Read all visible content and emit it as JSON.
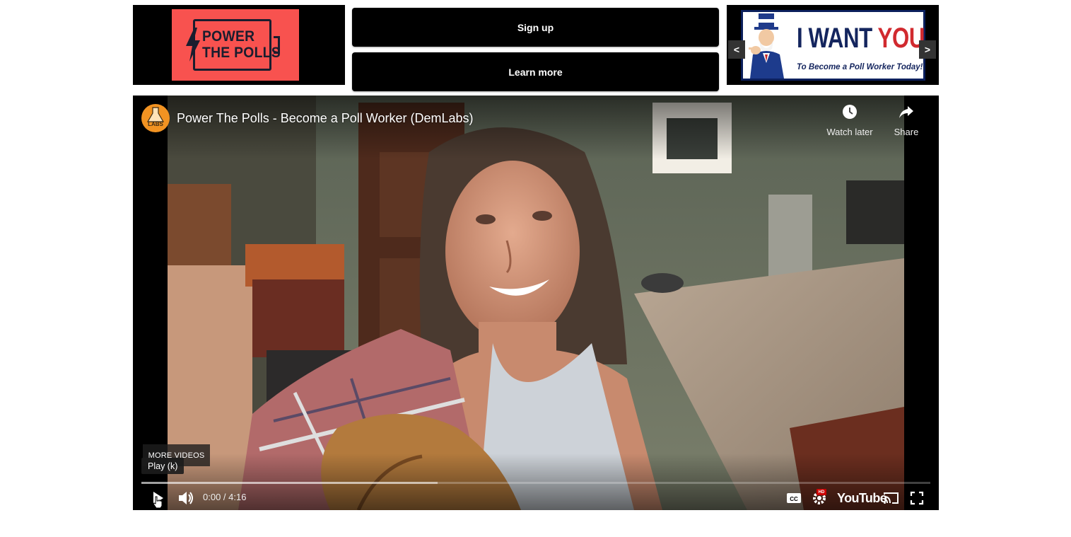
{
  "header": {
    "logo": {
      "line1": "POWER",
      "line2": "THE POLLS"
    },
    "buttons": {
      "signup": "Sign up",
      "learn_more": "Learn more"
    },
    "banner": {
      "headline_part1": "I WANT ",
      "headline_part2": "YOU",
      "subline": "To Become a Poll Worker Today!",
      "prev_label": "<",
      "next_label": ">"
    }
  },
  "video": {
    "title": "Power The Polls - Become a Poll Worker (DemLabs)",
    "channel_avatar_text": "LABS",
    "watch_later_label": "Watch later",
    "share_label": "Share",
    "more_videos_label": "MORE VIDEOS",
    "tooltip": "Play (k)",
    "time": "0:00 / 4:16",
    "progress_loaded": 0.375,
    "logo_label": "YouTube",
    "hd_label": "HD",
    "colors": {
      "brand_red": "#f8524f",
      "banner_red": "#d12a2f",
      "banner_navy": "#14255e",
      "youtube_red": "#cc0000"
    }
  }
}
